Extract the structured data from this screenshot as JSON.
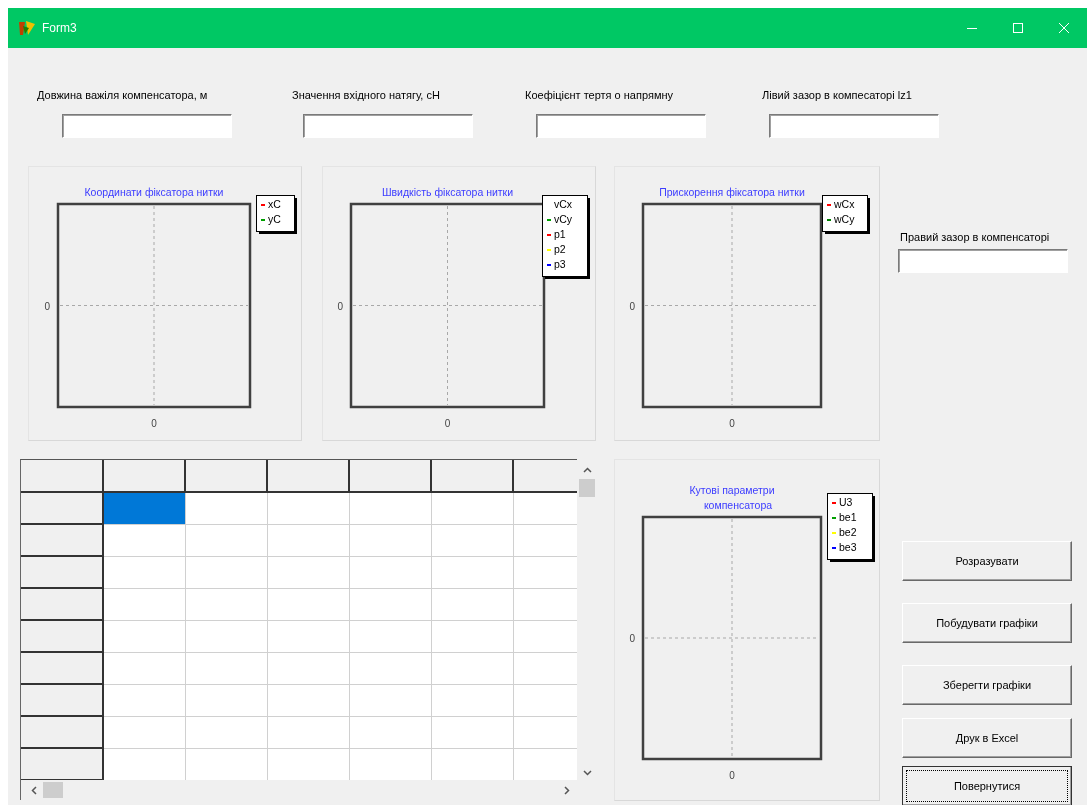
{
  "window": {
    "title": "Form3"
  },
  "fields": [
    {
      "label": "Довжина важіля компенсатора, м"
    },
    {
      "label": "Значення вхідного натягу, сН"
    },
    {
      "label": "Коефіцієнт тертя о напрямну"
    },
    {
      "label": "Лівий зазор в компесаторі lz1"
    }
  ],
  "right_field": {
    "label": "Правий зазор в компенсаторі"
  },
  "charts": [
    {
      "title_lines": [
        "Координати фіксатора нитки"
      ],
      "x_tick": "0",
      "y_tick": "0",
      "legend": [
        {
          "name": "xC",
          "color": "#ff0000"
        },
        {
          "name": "yC",
          "color": "#00a000"
        }
      ]
    },
    {
      "title_lines": [
        "Швидкість фіксатора нитки"
      ],
      "x_tick": "0",
      "y_tick": "0",
      "legend": [
        {
          "name": "vCx"
        },
        {
          "name": "vCy",
          "color": "#00a000"
        },
        {
          "name": "p1",
          "color": "#ff0000"
        },
        {
          "name": "p2",
          "color": "#ffff00"
        },
        {
          "name": "p3",
          "color": "#0000ff"
        }
      ]
    },
    {
      "title_lines": [
        "Прискорення фіксатора нитки"
      ],
      "x_tick": "0",
      "y_tick": "0",
      "legend": [
        {
          "name": "wCx",
          "color": "#ff0000"
        },
        {
          "name": "wCy",
          "color": "#008000"
        }
      ]
    },
    {
      "title_lines": [
        "Кутові параметри",
        "компенсатора"
      ],
      "x_tick": "0",
      "y_tick": "0",
      "legend": [
        {
          "name": "U3",
          "color": "#ff0000"
        },
        {
          "name": "be1",
          "color": "#00a000"
        },
        {
          "name": "be2",
          "color": "#ffff00"
        },
        {
          "name": "be3",
          "color": "#0000ff"
        }
      ]
    }
  ],
  "grid": {
    "rows": [
      {
        "cells": [
          {
            "selected": true
          },
          {
            "selected": false
          },
          {
            "selected": false
          },
          {
            "selected": false
          },
          {
            "selected": false
          },
          {
            "selected": false
          }
        ]
      },
      {
        "cells": [
          {
            "selected": false
          },
          {
            "selected": false
          },
          {
            "selected": false
          },
          {
            "selected": false
          },
          {
            "selected": false
          },
          {
            "selected": false
          }
        ]
      },
      {
        "cells": [
          {
            "selected": false
          },
          {
            "selected": false
          },
          {
            "selected": false
          },
          {
            "selected": false
          },
          {
            "selected": false
          },
          {
            "selected": false
          }
        ]
      },
      {
        "cells": [
          {
            "selected": false
          },
          {
            "selected": false
          },
          {
            "selected": false
          },
          {
            "selected": false
          },
          {
            "selected": false
          },
          {
            "selected": false
          }
        ]
      },
      {
        "cells": [
          {
            "selected": false
          },
          {
            "selected": false
          },
          {
            "selected": false
          },
          {
            "selected": false
          },
          {
            "selected": false
          },
          {
            "selected": false
          }
        ]
      },
      {
        "cells": [
          {
            "selected": false
          },
          {
            "selected": false
          },
          {
            "selected": false
          },
          {
            "selected": false
          },
          {
            "selected": false
          },
          {
            "selected": false
          }
        ]
      },
      {
        "cells": [
          {
            "selected": false
          },
          {
            "selected": false
          },
          {
            "selected": false
          },
          {
            "selected": false
          },
          {
            "selected": false
          },
          {
            "selected": false
          }
        ]
      },
      {
        "cells": [
          {
            "selected": false
          },
          {
            "selected": false
          },
          {
            "selected": false
          },
          {
            "selected": false
          },
          {
            "selected": false
          },
          {
            "selected": false
          }
        ]
      },
      {
        "cells": [
          {
            "selected": false
          },
          {
            "selected": false
          },
          {
            "selected": false
          },
          {
            "selected": false
          },
          {
            "selected": false
          },
          {
            "selected": false
          }
        ]
      }
    ]
  },
  "buttons": [
    {
      "label": "Розразувати",
      "focused": false
    },
    {
      "label": "Побудувати графіки",
      "focused": false
    },
    {
      "label": "Зберегти графіки",
      "focused": false
    },
    {
      "label": "Друк в Excel",
      "focused": false
    },
    {
      "label": "Повернутися",
      "focused": true
    }
  ]
}
